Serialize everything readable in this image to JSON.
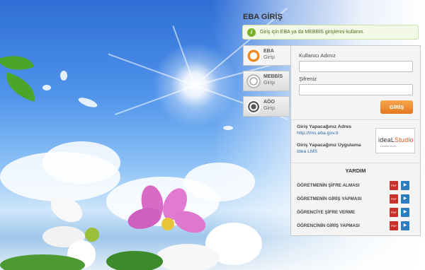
{
  "title": "EBA GİRİŞ",
  "notice": "Giriş için EBA ya da MEBBİS girişlerini kullanın.",
  "tabs": [
    {
      "label": "EBA",
      "sub": "Girişi"
    },
    {
      "label": "MEBBİS",
      "sub": "Girişi"
    },
    {
      "label": "AÖO",
      "sub": "Girişi"
    }
  ],
  "form": {
    "username_label": "Kullanıcı Adınız",
    "password_label": "Şifreniz",
    "username_value": "",
    "password_value": "",
    "login_button": "GİRİŞ"
  },
  "info": {
    "address_label": "Giriş Yapacağınız Adres",
    "address_value": "http://lms.eba.gov.tr",
    "app_label": "Giriş Yapacağınız Uygulama",
    "app_value": "Idea LMS"
  },
  "logo": {
    "text_a": "ideaL",
    "text_b": "Studio",
    "tagline": "creative studio"
  },
  "help": {
    "title": "YARDIM",
    "items": [
      "ÖĞRETMENİN ŞİFRE ALMASI",
      "ÖĞRETMENİN GİRİŞ YAPMASI",
      "ÖĞRENCİYE ŞİFRE VERME",
      "ÖĞRENCİNİN GİRİŞ YAPMASI"
    ],
    "pdf_label": "PDF"
  }
}
